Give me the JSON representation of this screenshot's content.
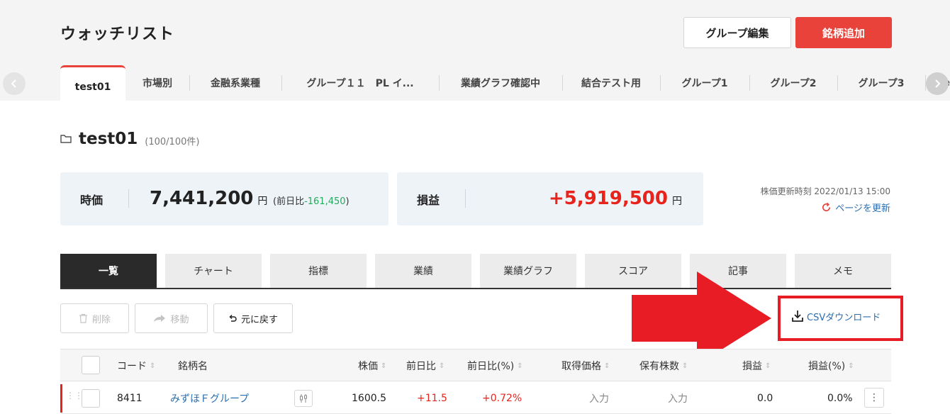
{
  "header": {
    "title": "ウォッチリスト",
    "group_edit_label": "グループ編集",
    "add_stock_label": "銘柄追加"
  },
  "group_tabs": [
    {
      "label": "test01",
      "active": true
    },
    {
      "label": "市場別"
    },
    {
      "label": "金融系業種"
    },
    {
      "label": "グループ１１　PL イ..."
    },
    {
      "label": "業績グラフ確認中"
    },
    {
      "label": "結合テスト用"
    },
    {
      "label": "グループ1"
    },
    {
      "label": "グループ2"
    },
    {
      "label": "グループ3"
    },
    {
      "label": "te"
    }
  ],
  "folder": {
    "name": "test01",
    "count": "(100/100件)"
  },
  "summary": {
    "price_label": "時価",
    "price_value": "7,441,200",
    "yen": "円",
    "prev_prefix": "(前日比",
    "prev_value": "-161,450",
    "prev_suffix": ")",
    "pl_label": "損益",
    "pl_value": "+5,919,500"
  },
  "update": {
    "time_text": "株価更新時刻 2022/01/13 15:00",
    "refresh_label": "ページを更新"
  },
  "view_tabs": [
    {
      "label": "一覧",
      "active": true
    },
    {
      "label": "チャート"
    },
    {
      "label": "指標"
    },
    {
      "label": "業績"
    },
    {
      "label": "業績グラフ"
    },
    {
      "label": "スコア"
    },
    {
      "label": "記事"
    },
    {
      "label": "メモ"
    }
  ],
  "toolbar": {
    "delete_label": "削除",
    "move_label": "移動",
    "undo_label": "元に戻す",
    "csv_label": "CSVダウンロード"
  },
  "table": {
    "columns": {
      "code": "コード",
      "name": "銘柄名",
      "price": "株価",
      "change": "前日比",
      "change_pct": "前日比(%)",
      "cost": "取得価格",
      "shares": "保有株数",
      "pl": "損益",
      "pl_pct": "損益(%)"
    },
    "rows": [
      {
        "code": "8411",
        "name": "みずほＦグループ",
        "price": "1600.5",
        "change": "+11.5",
        "change_pct": "+0.72%",
        "cost": "入力",
        "shares": "入力",
        "pl": "0.0",
        "pl_pct": "0.0%"
      }
    ]
  },
  "colors": {
    "accent_red": "#e8423b",
    "price_up": "#e8231c",
    "price_down_green": "#25a960",
    "link_blue": "#2a6fb0"
  }
}
